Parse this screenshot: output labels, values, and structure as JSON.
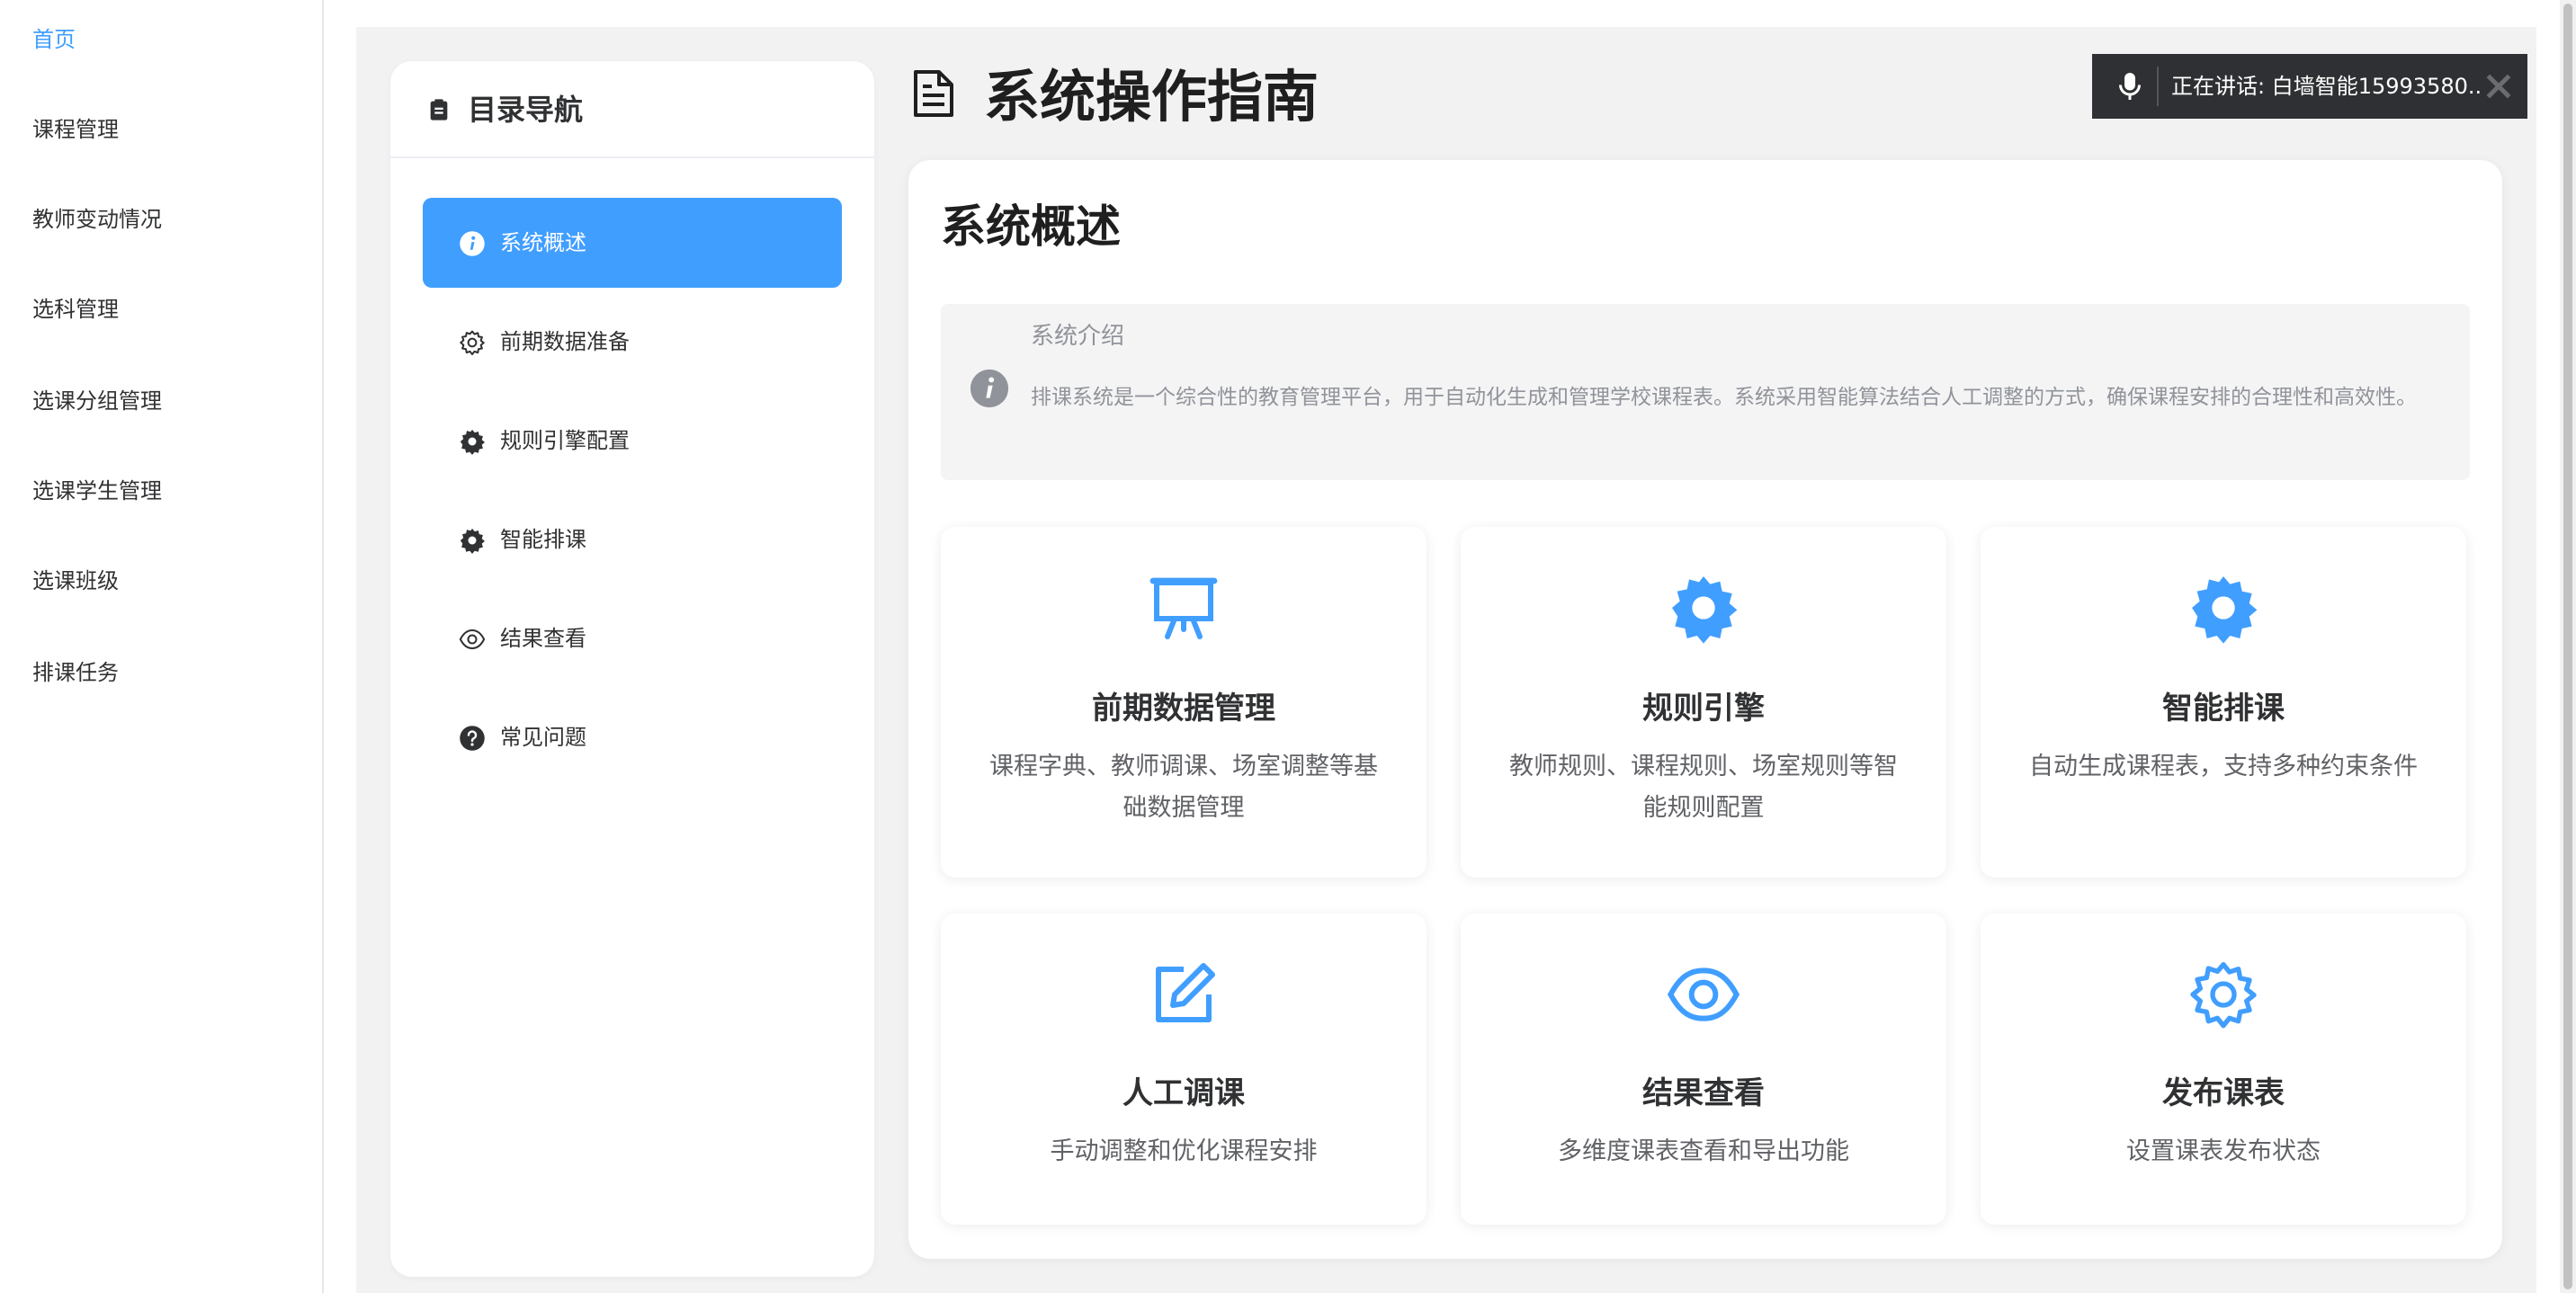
{
  "left_menu": {
    "items": [
      {
        "label": "首页",
        "active": true
      },
      {
        "label": "课程管理"
      },
      {
        "label": "教师变动情况"
      },
      {
        "label": "选科管理"
      },
      {
        "label": "选课分组管理"
      },
      {
        "label": "选课学生管理"
      },
      {
        "label": "选课班级"
      },
      {
        "label": "排课任务"
      }
    ]
  },
  "nav": {
    "title": "目录导航",
    "title_icon": "clipboard-icon",
    "items": [
      {
        "label": "系统概述",
        "icon": "info-icon",
        "active": true
      },
      {
        "label": "前期数据准备",
        "icon": "gear-outline-icon"
      },
      {
        "label": "规则引擎配置",
        "icon": "gear-icon"
      },
      {
        "label": "智能排课",
        "icon": "gear-icon"
      },
      {
        "label": "结果查看",
        "icon": "eye-icon"
      },
      {
        "label": "常见问题",
        "icon": "question-icon"
      }
    ]
  },
  "page": {
    "title": "系统操作指南",
    "title_icon": "document-icon"
  },
  "speaking": {
    "text": "正在讲话:  白墙智能15993580..",
    "icon": "microphone-icon"
  },
  "overview": {
    "title": "系统概述",
    "info": {
      "title": "系统介绍",
      "desc": "排课系统是一个综合性的教育管理平台，用于自动化生成和管理学校课程表。系统采用智能算法结合人工调整的方式，确保课程安排的合理性和高效性。"
    },
    "features": [
      {
        "title": "前期数据管理",
        "desc": "课程字典、教师调课、场室调整等基础数据管理",
        "icon": "presentation-icon"
      },
      {
        "title": "规则引擎",
        "desc": "教师规则、课程规则、场室规则等智能规则配置",
        "icon": "gear-icon"
      },
      {
        "title": "智能排课",
        "desc": "自动生成课程表，支持多种约束条件",
        "icon": "gear-icon"
      },
      {
        "title": "人工调课",
        "desc": "手动调整和优化课程安排",
        "icon": "edit-icon"
      },
      {
        "title": "结果查看",
        "desc": "多维度课表查看和导出功能",
        "icon": "eye-icon"
      },
      {
        "title": "发布课表",
        "desc": "设置课表发布状态",
        "icon": "gear-outline-icon"
      }
    ]
  },
  "colors": {
    "accent": "#409eff",
    "icon_blue": "#409eff",
    "text_dark": "#303133",
    "text_muted": "#909399",
    "toast_bg": "#2f3033"
  }
}
